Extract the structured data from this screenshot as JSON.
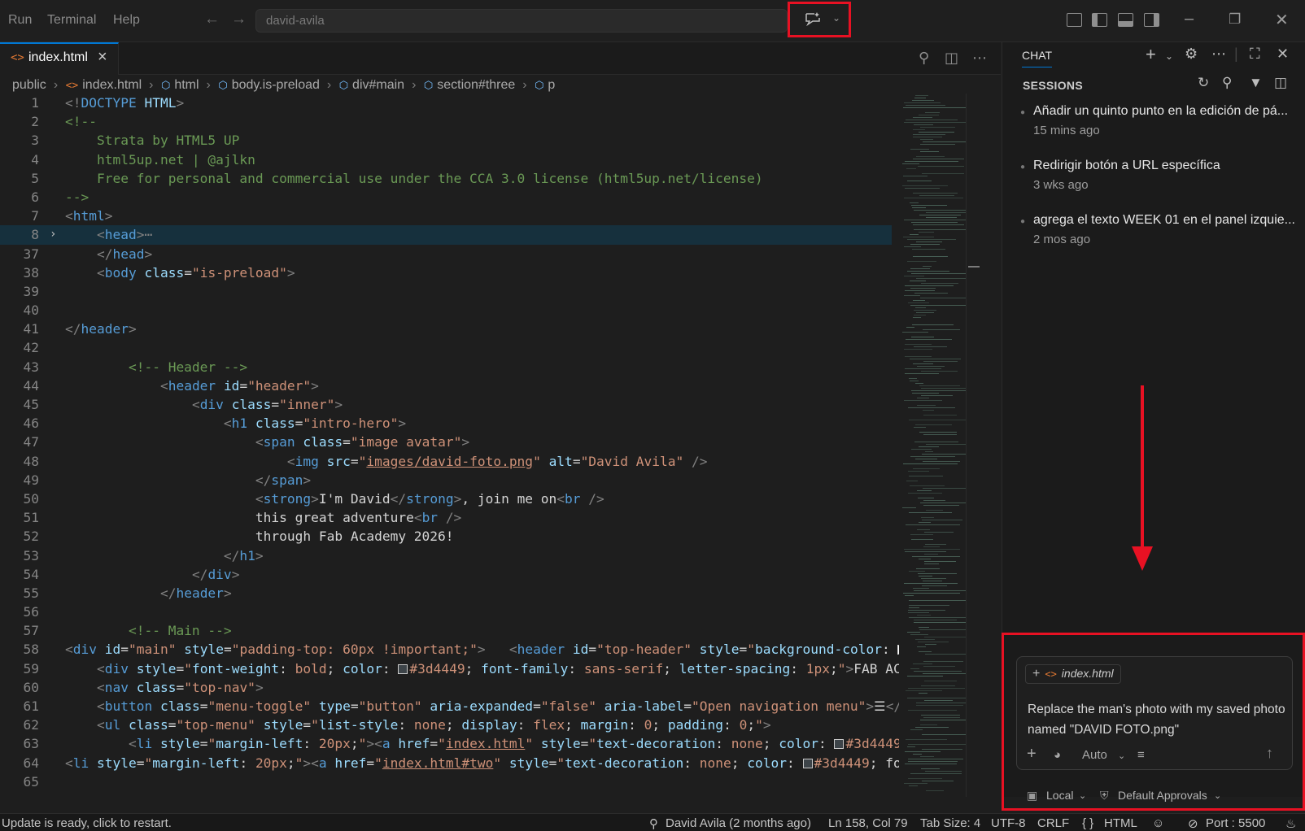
{
  "menu": {
    "run": "Run",
    "terminal": "Terminal",
    "help": "Help"
  },
  "search": {
    "text": "david-avila"
  },
  "editor": {
    "tab_label": "index.html",
    "tab_icon": "<>",
    "breadcrumb": [
      "public",
      "index.html",
      "html",
      "body.is-preload",
      "div#main",
      "section#three",
      "p"
    ],
    "code_lines": [
      {
        "n": "1"
      },
      {
        "n": "2"
      },
      {
        "n": "3"
      },
      {
        "n": "4"
      },
      {
        "n": "5"
      },
      {
        "n": "6"
      },
      {
        "n": "7"
      },
      {
        "n": "8"
      },
      {
        "n": "37"
      },
      {
        "n": "38"
      },
      {
        "n": "39"
      },
      {
        "n": "40"
      },
      {
        "n": "41"
      },
      {
        "n": "42"
      },
      {
        "n": "43"
      },
      {
        "n": "44"
      },
      {
        "n": "45"
      },
      {
        "n": "46"
      },
      {
        "n": "47"
      },
      {
        "n": "48"
      },
      {
        "n": "49"
      },
      {
        "n": "50"
      },
      {
        "n": "51"
      },
      {
        "n": "52"
      },
      {
        "n": "53"
      },
      {
        "n": "54"
      },
      {
        "n": "55"
      },
      {
        "n": "56"
      },
      {
        "n": "57"
      },
      {
        "n": "58"
      },
      {
        "n": "59"
      },
      {
        "n": "60"
      },
      {
        "n": "61"
      },
      {
        "n": "62"
      },
      {
        "n": "63"
      },
      {
        "n": "64"
      },
      {
        "n": "65"
      }
    ]
  },
  "chat": {
    "tab": "CHAT",
    "sessions_title": "SESSIONS",
    "sessions": [
      {
        "title": "Añadir un quinto punto en la edición de pá...",
        "time": "15 mins ago"
      },
      {
        "title": "Redirigir botón a URL específica",
        "time": "3 wks ago"
      },
      {
        "title": "agrega el texto WEEK 01 en el panel izquie...",
        "time": "2 mos ago"
      }
    ],
    "attachment": "index.html",
    "prompt": "Replace the man's photo with my saved photo named \"DAVID FOTO.png\"",
    "mode": "Auto",
    "location": "Local",
    "approvals": "Default Approvals"
  },
  "status": {
    "update": "Update is ready, click to restart.",
    "blame": "David Avila (2 months ago)",
    "position": "Ln 158, Col 79",
    "tab_size": "Tab Size: 4",
    "encoding": "UTF-8",
    "eol": "CRLF",
    "language": "HTML",
    "port": "Port : 5500"
  },
  "colors": {
    "accent": "#0078d4",
    "highlight_box": "#e81123",
    "html_icon": "#e37933"
  }
}
